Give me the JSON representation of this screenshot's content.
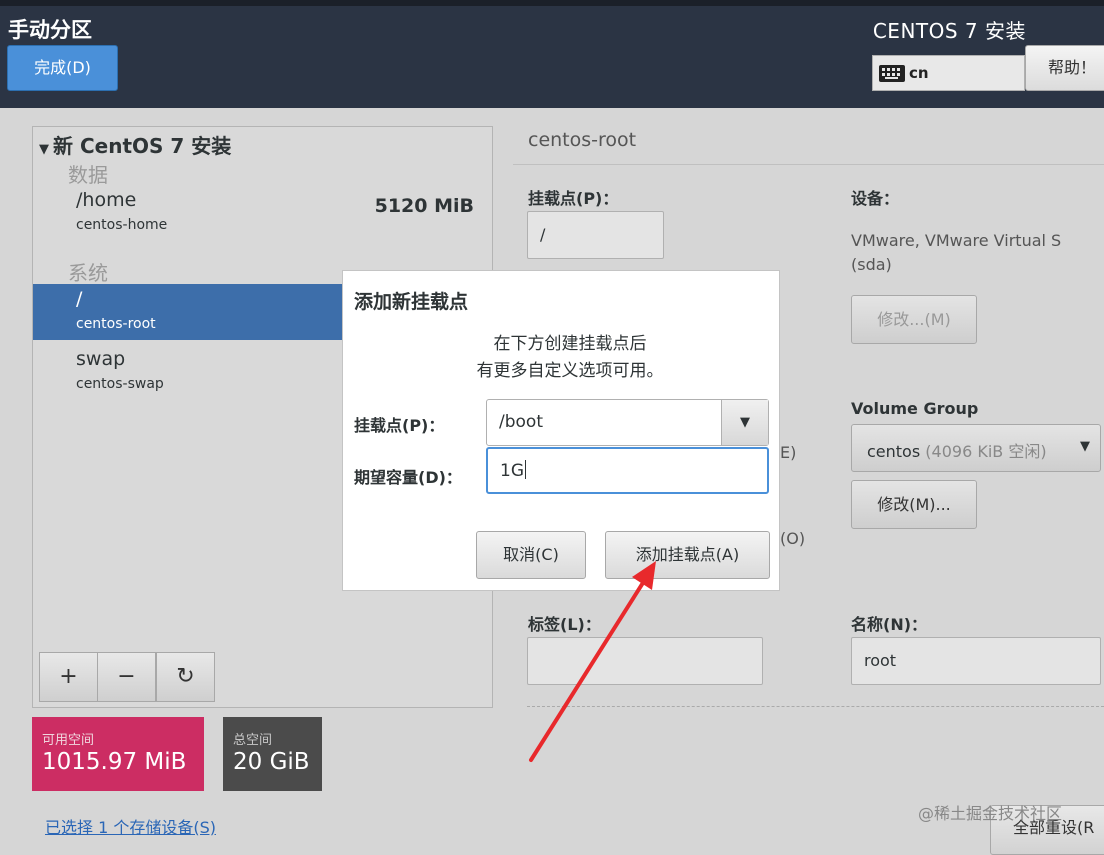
{
  "header": {
    "page_title": "手动分区",
    "done_label": "完成(D)",
    "product_title": "CENTOS 7 安装",
    "keyboard_layout": "cn",
    "help_label": "帮助！"
  },
  "left_panel": {
    "install_title": "新 CentOS 7 安装",
    "groups": [
      {
        "label": "数据"
      },
      {
        "label": "系统"
      }
    ],
    "mounts": [
      {
        "mount_point": "/home",
        "device": "centos-home",
        "size": "5120 MiB"
      },
      {
        "mount_point": "/",
        "device": "centos-root",
        "size": ""
      },
      {
        "mount_point": "swap",
        "device": "centos-swap",
        "size": ""
      }
    ],
    "toolbar": {
      "add": "+",
      "remove": "−",
      "refresh": "↻"
    }
  },
  "space": {
    "available_label": "可用空间",
    "available_value": "1015.97 MiB",
    "total_label": "总空间",
    "total_value": "20 GiB"
  },
  "storage_link": "已选择 1 个存储设备(S)",
  "right_panel": {
    "title": "centos-root",
    "mount_point_label": "挂载点(P)：",
    "mount_point_value": "/",
    "device_label": "设备：",
    "device_text_1": "VMware, VMware Virtual S",
    "device_text_2": "(sda)",
    "modify_label": "修改...(M)",
    "volume_group_label": "Volume Group",
    "volume_group_name": "centos",
    "volume_group_free": "(4096 KiB 空闲)",
    "modify_vg_label": "修改(M)...",
    "partial_e": "E)",
    "partial_o": "(O)",
    "tag_label": "标签(L)：",
    "tag_value": "",
    "name_label": "名称(N)：",
    "name_value": "root",
    "reset_label": "全部重设(R"
  },
  "watermark": "@稀土掘金技术社区",
  "modal": {
    "title": "添加新挂载点",
    "desc_line1": "在下方创建挂载点后",
    "desc_line2": "有更多自定义选项可用。",
    "mount_label": "挂载点(P)：",
    "mount_value": "/boot",
    "capacity_label": "期望容量(D)：",
    "capacity_value": "1G",
    "cancel_label": "取消(C)",
    "add_label": "添加挂载点(A)"
  },
  "colors": {
    "header_bg": "#2b3444",
    "accent_blue": "#4a90d9",
    "selected_row": "#3d6eaa",
    "available_space": "#cc2d63",
    "total_space": "#4b4b4b",
    "annotation_arrow": "#e8292c"
  },
  "icons": {
    "keyboard": "keyboard-icon",
    "expander": "triangle-down-icon",
    "combo_arrow": "chevron-down-icon",
    "refresh": "refresh-icon"
  }
}
